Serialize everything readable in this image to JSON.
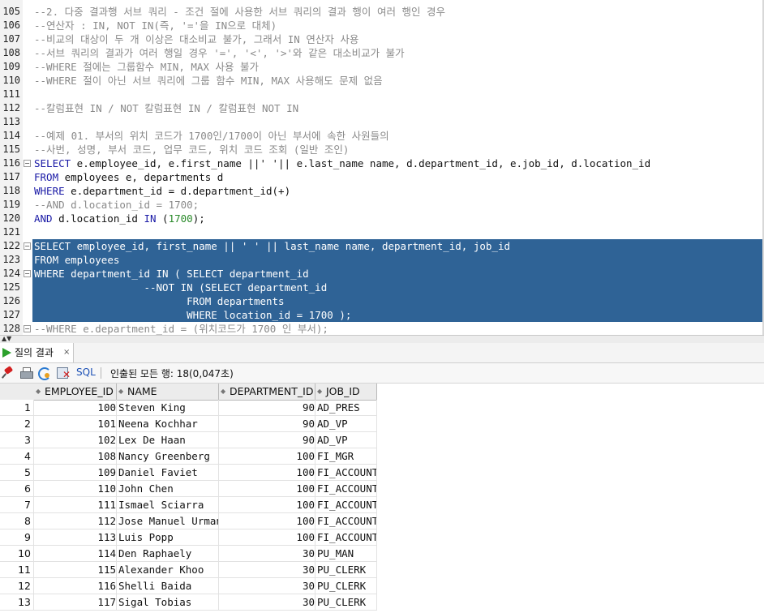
{
  "editor": {
    "lines": [
      {
        "n": "105",
        "t": "--2. 다중 결과행 서브 쿼리 - 조건 절에 사용한 서브 쿼리의 결과 행이 여러 행인 경우"
      },
      {
        "n": "106",
        "t": "--연산자 : IN, NOT IN(즉, '='을 IN으로 대체)"
      },
      {
        "n": "107",
        "t": "--비교의 대상이 두 개 이상은 대소비교 불가, 그래서 IN 연산자 사용"
      },
      {
        "n": "108",
        "t": "--서브 쿼리의 결과가 여러 행일 경우 '=', '<', '>'와 같은 대소비교가 불가"
      },
      {
        "n": "109",
        "t": "--WHERE 절에는 그룹함수 MIN, MAX 사용 불가"
      },
      {
        "n": "110",
        "t": "--WHERE 절이 아닌 서브 쿼리에 그룹 함수 MIN, MAX 사용해도 문제 없음"
      },
      {
        "n": "111",
        "t": ""
      },
      {
        "n": "112",
        "t": "--칼럼표현 IN / NOT 칼럼표현 IN / 칼럼표현 NOT IN"
      },
      {
        "n": "113",
        "t": ""
      },
      {
        "n": "114",
        "t": "--예제 01. 부서의 위치 코드가 1700인/1700이 아닌 부서에 속한 사원들의"
      },
      {
        "n": "115",
        "t": "--사번, 성명, 부서 코드, 업무 코드, 위치 코드 조회 (일반 조인)"
      },
      {
        "n": "116",
        "t": "SELECT e.employee_id, e.first_name ||' '|| e.last_name name, d.department_id, e.job_id, d.location_id"
      },
      {
        "n": "117",
        "t": "FROM employees e, departments d"
      },
      {
        "n": "118",
        "t": "WHERE e.department_id = d.department_id(+)"
      },
      {
        "n": "119",
        "t": "--AND d.location_id = 1700;"
      },
      {
        "n": "120",
        "t": "AND d.location_id IN (1700);"
      },
      {
        "n": "121",
        "t": ""
      },
      {
        "n": "122",
        "t": "SELECT employee_id, first_name || ' ' || last_name name, department_id, job_id"
      },
      {
        "n": "123",
        "t": "FROM employees"
      },
      {
        "n": "124",
        "t": "WHERE department_id IN ( SELECT department_id"
      },
      {
        "n": "125",
        "t": "                  --NOT IN (SELECT department_id"
      },
      {
        "n": "126",
        "t": "                         FROM departments"
      },
      {
        "n": "127",
        "t": "                         WHERE location_id = 1700 );"
      },
      {
        "n": "128",
        "t": "--WHERE e.department_id = (위치코드가 1700 인 부서);"
      }
    ]
  },
  "tab": {
    "label": "질의 결과",
    "close": "×"
  },
  "toolbar": {
    "sql_label": "SQL",
    "status": "인출된 모든 행: 18(0,047초)"
  },
  "grid": {
    "columns": [
      "EMPLOYEE_ID",
      "NAME",
      "DEPARTMENT_ID",
      "JOB_ID"
    ],
    "rows": [
      [
        "1",
        "100",
        "Steven King",
        "90",
        "AD_PRES"
      ],
      [
        "2",
        "101",
        "Neena Kochhar",
        "90",
        "AD_VP"
      ],
      [
        "3",
        "102",
        "Lex De Haan",
        "90",
        "AD_VP"
      ],
      [
        "4",
        "108",
        "Nancy Greenberg",
        "100",
        "FI_MGR"
      ],
      [
        "5",
        "109",
        "Daniel Faviet",
        "100",
        "FI_ACCOUNT"
      ],
      [
        "6",
        "110",
        "John Chen",
        "100",
        "FI_ACCOUNT"
      ],
      [
        "7",
        "111",
        "Ismael Sciarra",
        "100",
        "FI_ACCOUNT"
      ],
      [
        "8",
        "112",
        "Jose Manuel Urman",
        "100",
        "FI_ACCOUNT"
      ],
      [
        "9",
        "113",
        "Luis Popp",
        "100",
        "FI_ACCOUNT"
      ],
      [
        "10",
        "114",
        "Den Raphaely",
        "30",
        "PU_MAN"
      ],
      [
        "11",
        "115",
        "Alexander Khoo",
        "30",
        "PU_CLERK"
      ],
      [
        "12",
        "116",
        "Shelli Baida",
        "30",
        "PU_CLERK"
      ],
      [
        "13",
        "117",
        "Sigal Tobias",
        "30",
        "PU_CLERK"
      ]
    ]
  }
}
